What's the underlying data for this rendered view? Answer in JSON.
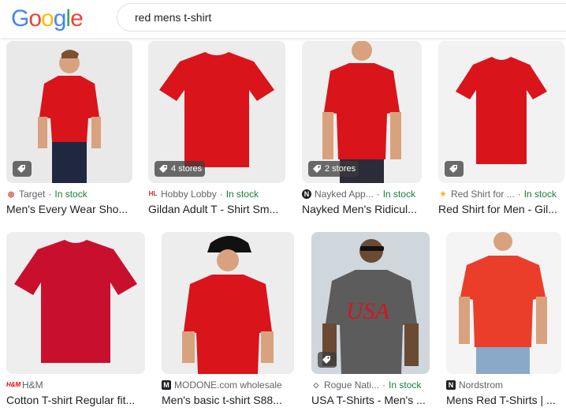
{
  "logo": "Google",
  "search": {
    "value": "red mens t-shirt"
  },
  "results": [
    {
      "source": "Target",
      "stock": "In stock",
      "title": "Men's Every Wear Sho...",
      "badge": "",
      "favicon": "◎",
      "fav_color": "#cc0000"
    },
    {
      "source": "Hobby Lobby",
      "stock": "In stock",
      "title": "Gildan Adult T - Shirt Sm...",
      "badge": "4 stores",
      "favicon": "HL",
      "fav_color": "#c62828"
    },
    {
      "source": "Nayked App...",
      "stock": "In stock",
      "title": "Nayked Men's Ridicul...",
      "badge": "2 stores",
      "favicon": "N",
      "fav_color": "#202124"
    },
    {
      "source": "Red Shirt for ...",
      "stock": "In stock",
      "title": "Red Shirt for Men - Gil...",
      "badge": "",
      "favicon": "✳",
      "fav_color": "#f9ab00"
    },
    {
      "source": "H&M",
      "stock": "",
      "title": "Cotton T-shirt Regular fit...",
      "badge": "",
      "favicon": "H&M",
      "fav_color": "#e50010"
    },
    {
      "source": "MODONE.com wholesale",
      "stock": "",
      "title": "Men's basic t-shirt S88...",
      "badge": "",
      "favicon": "M",
      "fav_color": "#202124"
    },
    {
      "source": "Rogue Nati...",
      "stock": "In stock",
      "title": "USA T-Shirts - Men's ...",
      "badge": "",
      "favicon": "◇",
      "fav_color": "#5f6368"
    },
    {
      "source": "Nordstrom",
      "stock": "",
      "title": "Mens Red T-Shirts | ...",
      "badge": "",
      "favicon": "N",
      "fav_color": "#202124"
    }
  ],
  "colors": {
    "shirt_red": "#d9141b",
    "in_stock": "#188038",
    "brand_blue": "#4285f4",
    "brand_red": "#ea4335",
    "brand_yellow": "#fbbc05",
    "brand_green": "#34a853"
  }
}
